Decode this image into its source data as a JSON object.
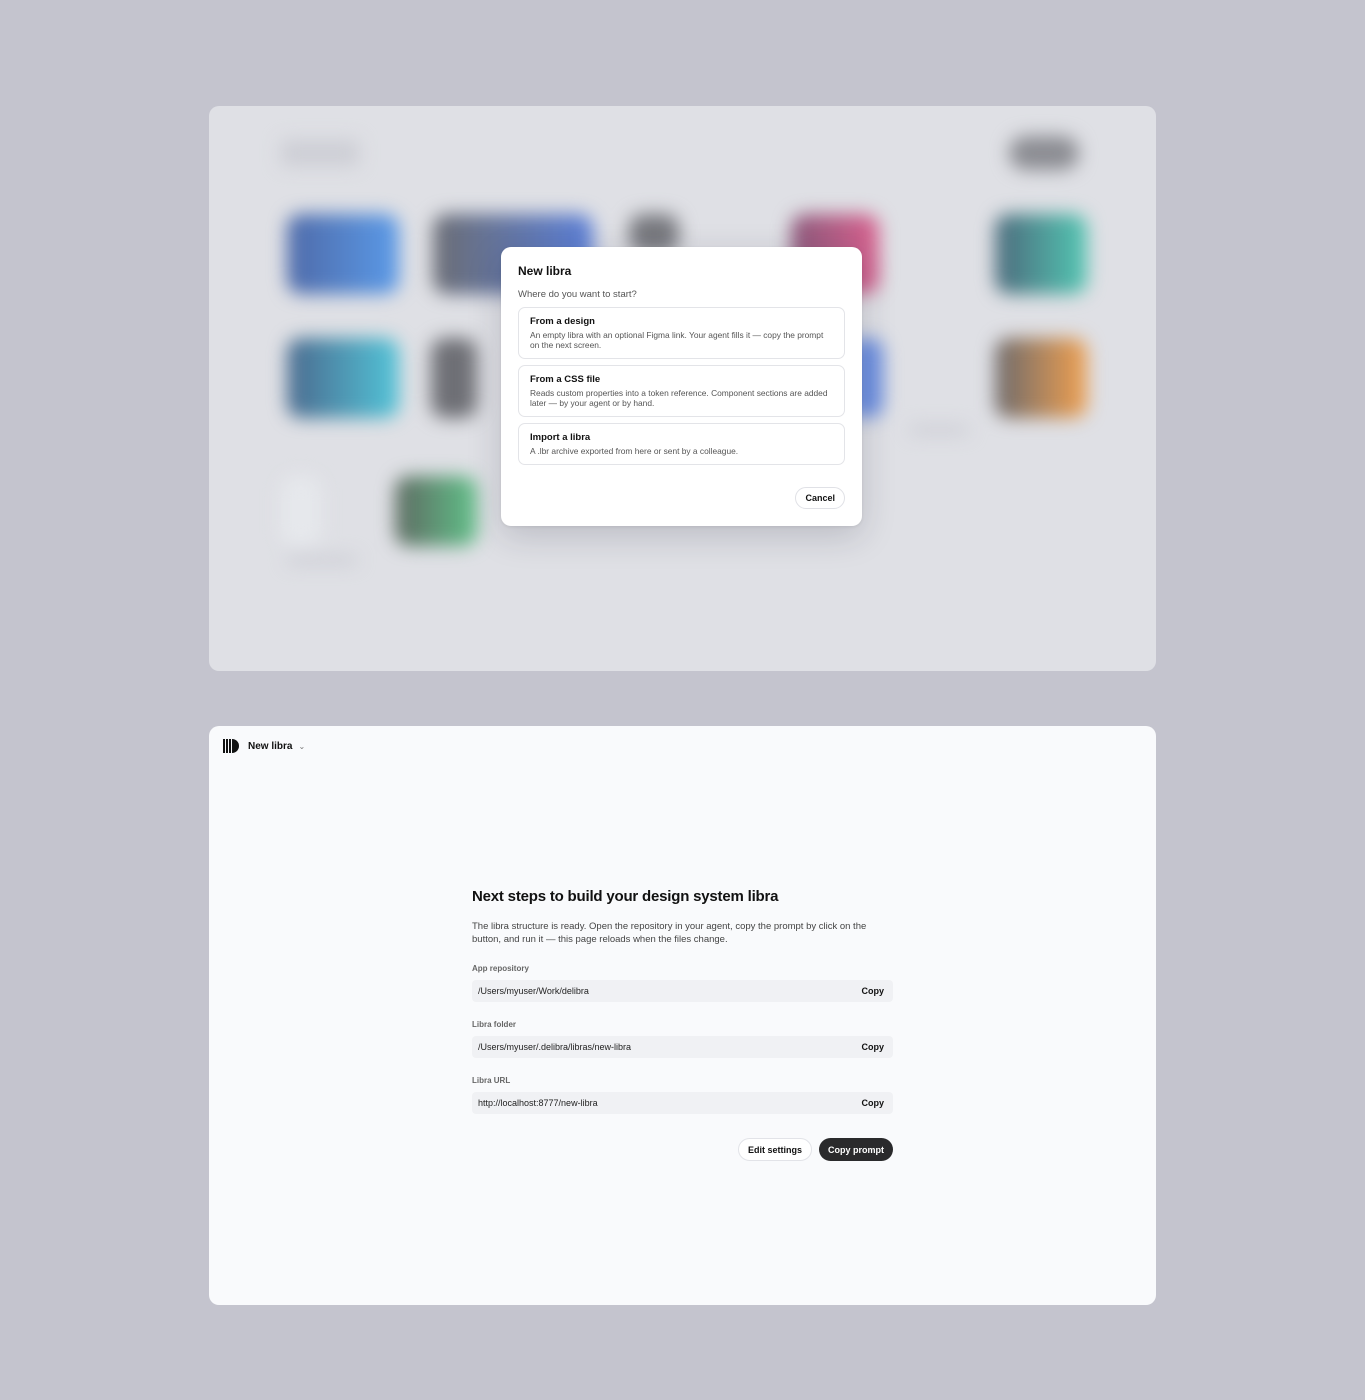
{
  "modal": {
    "title": "New libra",
    "subtitle": "Where do you want to start?",
    "options": [
      {
        "title": "From a design",
        "description": "An empty libra with an optional Figma link. Your agent fills it — copy the prompt on the next screen."
      },
      {
        "title": "From a CSS file",
        "description": "Reads custom properties into a token reference. Component sections are added later — by your agent or by hand."
      },
      {
        "title": "Import a libra",
        "description": "A .lbr archive exported from here or sent by a colleague."
      }
    ],
    "cancel_label": "Cancel"
  },
  "header": {
    "app_name": "New libra",
    "logo_icon": "libra-logo-icon",
    "dropdown_icon": "chevron-down-icon"
  },
  "next_steps": {
    "title": "Next steps to build your design system libra",
    "description": "The libra structure is ready. Open the repository in your agent, copy the prompt by click on the button, and run it — this page reloads when the files change.",
    "fields": [
      {
        "label": "App repository",
        "value": "/Users/myuser/Work/delibra",
        "copy_label": "Copy"
      },
      {
        "label": "Libra folder",
        "value": "/Users/myuser/.delibra/libras/new-libra",
        "copy_label": "Copy"
      },
      {
        "label": "Libra URL",
        "value": "http://localhost:8777/new-libra",
        "copy_label": "Copy"
      }
    ],
    "edit_settings_label": "Edit settings",
    "copy_prompt_label": "Copy prompt"
  },
  "colors": {
    "page_background": "#c4c4ce",
    "primary_button": "#2a2a2c",
    "surface": "#f9fafc"
  }
}
